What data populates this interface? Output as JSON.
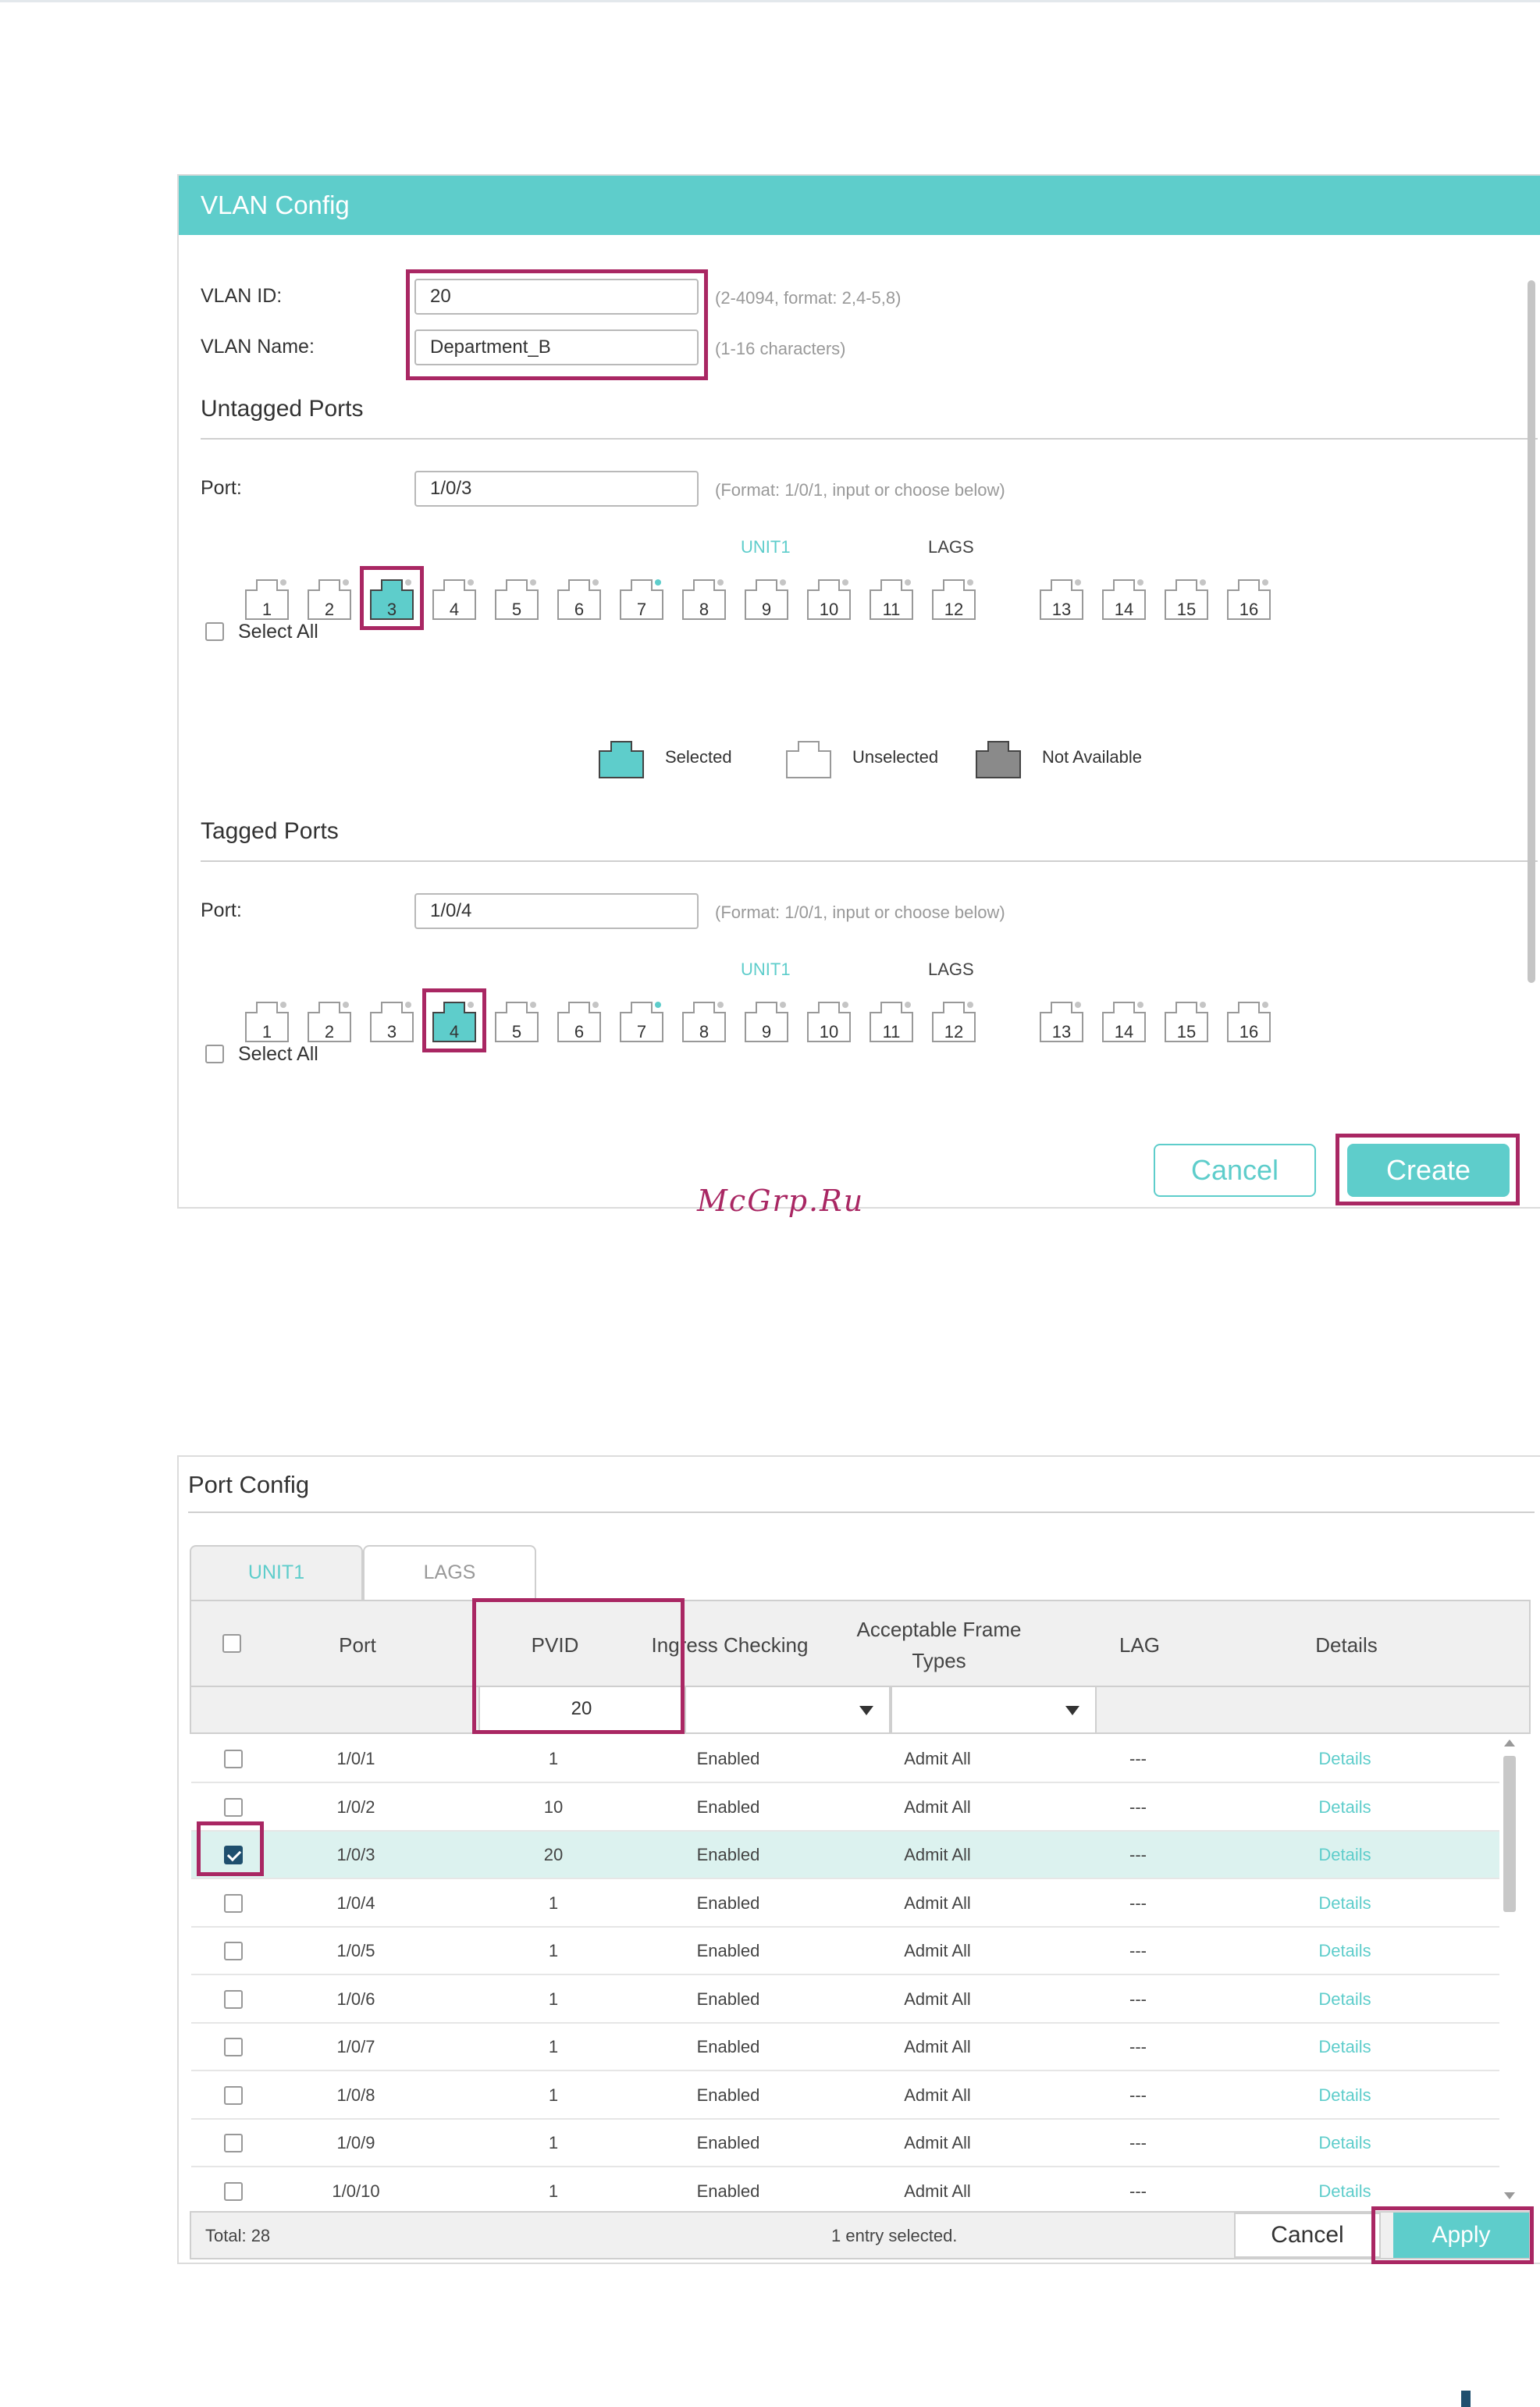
{
  "vlan_config": {
    "title": "VLAN Config",
    "vlan_id": {
      "label": "VLAN ID:",
      "value": "20",
      "hint": "(2-4094, format: 2,4-5,8)"
    },
    "vlan_name": {
      "label": "VLAN Name:",
      "value": "Department_B",
      "hint": "(1-16 characters)"
    },
    "untagged": {
      "title": "Untagged Ports",
      "port_label": "Port:",
      "port_value": "1/0/3",
      "port_hint": "(Format: 1/0/1, input or choose below)",
      "unit_label": "UNIT1",
      "lags_label": "LAGS",
      "select_all": "Select All",
      "selected_port": "3"
    },
    "legend": {
      "selected": "Selected",
      "unselected": "Unselected",
      "not_available": "Not Available"
    },
    "tagged": {
      "title": "Tagged Ports",
      "port_label": "Port:",
      "port_value": "1/0/4",
      "port_hint": "(Format: 1/0/1, input or choose below)",
      "unit_label": "UNIT1",
      "lags_label": "LAGS",
      "select_all": "Select All",
      "selected_port": "4"
    },
    "ports": [
      "1",
      "2",
      "3",
      "4",
      "5",
      "6",
      "7",
      "8",
      "9",
      "10",
      "11",
      "12",
      "13",
      "14",
      "15",
      "16"
    ],
    "cancel_label": "Cancel",
    "create_label": "Create"
  },
  "watermark": "McGrp.Ru",
  "port_config": {
    "title": "Port Config",
    "tabs": [
      "UNIT1",
      "LAGS"
    ],
    "columns": {
      "port": "Port",
      "pvid": "PVID",
      "ingress": "Ingress Checking",
      "frame_types": "Acceptable Frame Types",
      "lag": "LAG",
      "details": "Details"
    },
    "filter_pvid": "20",
    "rows": [
      {
        "port": "1/0/1",
        "pvid": "1",
        "ingress": "Enabled",
        "frame": "Admit All",
        "lag": "---",
        "details": "Details",
        "checked": false
      },
      {
        "port": "1/0/2",
        "pvid": "10",
        "ingress": "Enabled",
        "frame": "Admit All",
        "lag": "---",
        "details": "Details",
        "checked": false
      },
      {
        "port": "1/0/3",
        "pvid": "20",
        "ingress": "Enabled",
        "frame": "Admit All",
        "lag": "---",
        "details": "Details",
        "checked": true
      },
      {
        "port": "1/0/4",
        "pvid": "1",
        "ingress": "Enabled",
        "frame": "Admit All",
        "lag": "---",
        "details": "Details",
        "checked": false
      },
      {
        "port": "1/0/5",
        "pvid": "1",
        "ingress": "Enabled",
        "frame": "Admit All",
        "lag": "---",
        "details": "Details",
        "checked": false
      },
      {
        "port": "1/0/6",
        "pvid": "1",
        "ingress": "Enabled",
        "frame": "Admit All",
        "lag": "---",
        "details": "Details",
        "checked": false
      },
      {
        "port": "1/0/7",
        "pvid": "1",
        "ingress": "Enabled",
        "frame": "Admit All",
        "lag": "---",
        "details": "Details",
        "checked": false
      },
      {
        "port": "1/0/8",
        "pvid": "1",
        "ingress": "Enabled",
        "frame": "Admit All",
        "lag": "---",
        "details": "Details",
        "checked": false
      },
      {
        "port": "1/0/9",
        "pvid": "1",
        "ingress": "Enabled",
        "frame": "Admit All",
        "lag": "---",
        "details": "Details",
        "checked": false
      },
      {
        "port": "1/0/10",
        "pvid": "1",
        "ingress": "Enabled",
        "frame": "Admit All",
        "lag": "---",
        "details": "Details",
        "checked": false
      }
    ],
    "total": "Total: 28",
    "selection_status": "1 entry selected.",
    "cancel_label": "Cancel",
    "apply_label": "Apply"
  },
  "colors": {
    "accent": "#5ecdcb",
    "highlight": "#a92763",
    "not_available": "#8a8a8a",
    "selected_row": "#dcf2ef"
  }
}
